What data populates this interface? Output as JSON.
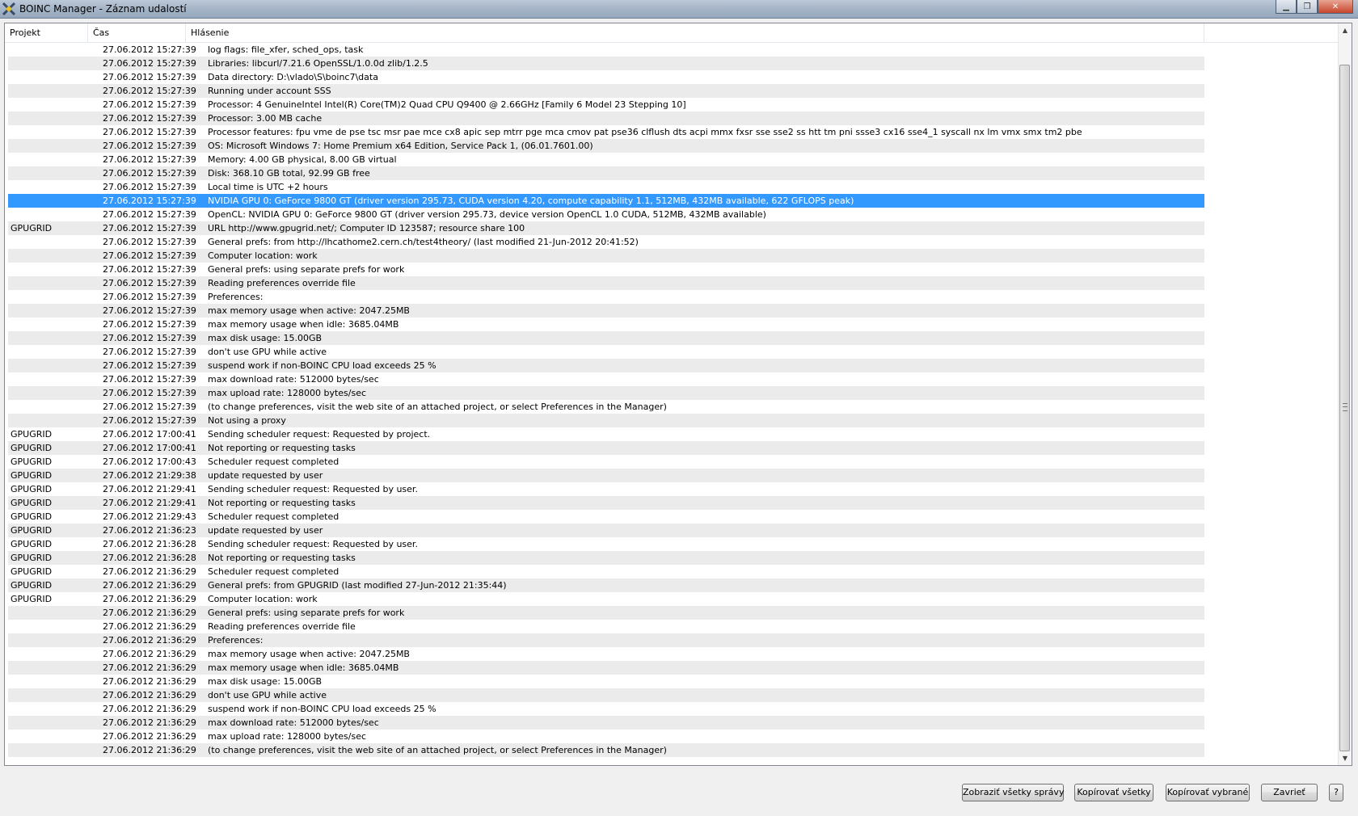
{
  "window": {
    "title": "BOINC Manager - Záznam udalostí"
  },
  "columns": {
    "project": "Projekt",
    "time": "Čas",
    "message": "Hlásenie"
  },
  "rows": [
    {
      "project": "",
      "time": "27.06.2012 15:27:39",
      "message": "log flags: file_xfer, sched_ops, task"
    },
    {
      "project": "",
      "time": "27.06.2012 15:27:39",
      "message": "Libraries: libcurl/7.21.6 OpenSSL/1.0.0d zlib/1.2.5"
    },
    {
      "project": "",
      "time": "27.06.2012 15:27:39",
      "message": "Data directory: D:\\vlado\\S\\boinc7\\data"
    },
    {
      "project": "",
      "time": "27.06.2012 15:27:39",
      "message": "Running under account SSS"
    },
    {
      "project": "",
      "time": "27.06.2012 15:27:39",
      "message": "Processor: 4 GenuineIntel Intel(R) Core(TM)2 Quad CPU    Q9400  @ 2.66GHz [Family 6 Model 23 Stepping 10]"
    },
    {
      "project": "",
      "time": "27.06.2012 15:27:39",
      "message": "Processor: 3.00 MB cache"
    },
    {
      "project": "",
      "time": "27.06.2012 15:27:39",
      "message": "Processor features: fpu vme de pse tsc msr pae mce cx8 apic sep mtrr pge mca cmov pat pse36 clflush dts acpi mmx fxsr sse sse2 ss htt tm pni ssse3 cx16 sse4_1 syscall nx lm vmx smx tm2 pbe"
    },
    {
      "project": "",
      "time": "27.06.2012 15:27:39",
      "message": "OS: Microsoft Windows 7: Home Premium x64 Edition, Service Pack 1, (06.01.7601.00)"
    },
    {
      "project": "",
      "time": "27.06.2012 15:27:39",
      "message": "Memory: 4.00 GB physical, 8.00 GB virtual"
    },
    {
      "project": "",
      "time": "27.06.2012 15:27:39",
      "message": "Disk: 368.10 GB total, 92.99 GB free"
    },
    {
      "project": "",
      "time": "27.06.2012 15:27:39",
      "message": "Local time is UTC +2 hours"
    },
    {
      "project": "",
      "time": "27.06.2012 15:27:39",
      "message": "NVIDIA GPU 0: GeForce 9800 GT (driver version 295.73, CUDA version 4.20, compute capability 1.1, 512MB, 432MB available, 622 GFLOPS peak)",
      "selected": true
    },
    {
      "project": "",
      "time": "27.06.2012 15:27:39",
      "message": "OpenCL: NVIDIA GPU 0: GeForce 9800 GT (driver version 295.73, device version OpenCL 1.0 CUDA, 512MB, 432MB available)"
    },
    {
      "project": "GPUGRID",
      "time": "27.06.2012 15:27:39",
      "message": "URL http://www.gpugrid.net/; Computer ID 123587; resource share 100"
    },
    {
      "project": "",
      "time": "27.06.2012 15:27:39",
      "message": "General prefs: from http://lhcathome2.cern.ch/test4theory/ (last modified 21-Jun-2012 20:41:52)"
    },
    {
      "project": "",
      "time": "27.06.2012 15:27:39",
      "message": "Computer location: work"
    },
    {
      "project": "",
      "time": "27.06.2012 15:27:39",
      "message": "General prefs: using separate prefs for work"
    },
    {
      "project": "",
      "time": "27.06.2012 15:27:39",
      "message": "Reading preferences override file"
    },
    {
      "project": "",
      "time": "27.06.2012 15:27:39",
      "message": "Preferences:"
    },
    {
      "project": "",
      "time": "27.06.2012 15:27:39",
      "message": "max memory usage when active: 2047.25MB"
    },
    {
      "project": "",
      "time": "27.06.2012 15:27:39",
      "message": "max memory usage when idle: 3685.04MB"
    },
    {
      "project": "",
      "time": "27.06.2012 15:27:39",
      "message": "max disk usage: 15.00GB"
    },
    {
      "project": "",
      "time": "27.06.2012 15:27:39",
      "message": "don't use GPU while active"
    },
    {
      "project": "",
      "time": "27.06.2012 15:27:39",
      "message": "suspend work if non-BOINC CPU load exceeds 25 %"
    },
    {
      "project": "",
      "time": "27.06.2012 15:27:39",
      "message": "max download rate: 512000 bytes/sec"
    },
    {
      "project": "",
      "time": "27.06.2012 15:27:39",
      "message": "max upload rate: 128000 bytes/sec"
    },
    {
      "project": "",
      "time": "27.06.2012 15:27:39",
      "message": "(to change preferences, visit the web site of an attached project, or select Preferences in the Manager)"
    },
    {
      "project": "",
      "time": "27.06.2012 15:27:39",
      "message": "Not using a proxy"
    },
    {
      "project": "GPUGRID",
      "time": "27.06.2012 17:00:41",
      "message": "Sending scheduler request: Requested by project."
    },
    {
      "project": "GPUGRID",
      "time": "27.06.2012 17:00:41",
      "message": "Not reporting or requesting tasks"
    },
    {
      "project": "GPUGRID",
      "time": "27.06.2012 17:00:43",
      "message": "Scheduler request completed"
    },
    {
      "project": "GPUGRID",
      "time": "27.06.2012 21:29:38",
      "message": "update requested by user"
    },
    {
      "project": "GPUGRID",
      "time": "27.06.2012 21:29:41",
      "message": "Sending scheduler request: Requested by user."
    },
    {
      "project": "GPUGRID",
      "time": "27.06.2012 21:29:41",
      "message": "Not reporting or requesting tasks"
    },
    {
      "project": "GPUGRID",
      "time": "27.06.2012 21:29:43",
      "message": "Scheduler request completed"
    },
    {
      "project": "GPUGRID",
      "time": "27.06.2012 21:36:23",
      "message": "update requested by user"
    },
    {
      "project": "GPUGRID",
      "time": "27.06.2012 21:36:28",
      "message": "Sending scheduler request: Requested by user."
    },
    {
      "project": "GPUGRID",
      "time": "27.06.2012 21:36:28",
      "message": "Not reporting or requesting tasks"
    },
    {
      "project": "GPUGRID",
      "time": "27.06.2012 21:36:29",
      "message": "Scheduler request completed"
    },
    {
      "project": "GPUGRID",
      "time": "27.06.2012 21:36:29",
      "message": "General prefs: from GPUGRID (last modified 27-Jun-2012 21:35:44)"
    },
    {
      "project": "GPUGRID",
      "time": "27.06.2012 21:36:29",
      "message": "Computer location: work"
    },
    {
      "project": "",
      "time": "27.06.2012 21:36:29",
      "message": "General prefs: using separate prefs for work"
    },
    {
      "project": "",
      "time": "27.06.2012 21:36:29",
      "message": "Reading preferences override file"
    },
    {
      "project": "",
      "time": "27.06.2012 21:36:29",
      "message": "Preferences:"
    },
    {
      "project": "",
      "time": "27.06.2012 21:36:29",
      "message": "max memory usage when active: 2047.25MB"
    },
    {
      "project": "",
      "time": "27.06.2012 21:36:29",
      "message": "max memory usage when idle: 3685.04MB"
    },
    {
      "project": "",
      "time": "27.06.2012 21:36:29",
      "message": "max disk usage: 15.00GB"
    },
    {
      "project": "",
      "time": "27.06.2012 21:36:29",
      "message": "don't use GPU while active"
    },
    {
      "project": "",
      "time": "27.06.2012 21:36:29",
      "message": "suspend work if non-BOINC CPU load exceeds 25 %"
    },
    {
      "project": "",
      "time": "27.06.2012 21:36:29",
      "message": "max download rate: 512000 bytes/sec"
    },
    {
      "project": "",
      "time": "27.06.2012 21:36:29",
      "message": "max upload rate: 128000 bytes/sec"
    },
    {
      "project": "",
      "time": "27.06.2012 21:36:29",
      "message": "(to change preferences, visit the web site of an attached project, or select Preferences in the Manager)"
    }
  ],
  "buttons": {
    "show_all": "Zobraziť všetky správy",
    "copy_all": "Kopírovať všetky",
    "copy_selected": "Kopírovať vybrané",
    "close": "Zavrieť",
    "help": "?"
  },
  "colors": {
    "selection": "#3399ff",
    "alt_row": "#ebebeb"
  }
}
